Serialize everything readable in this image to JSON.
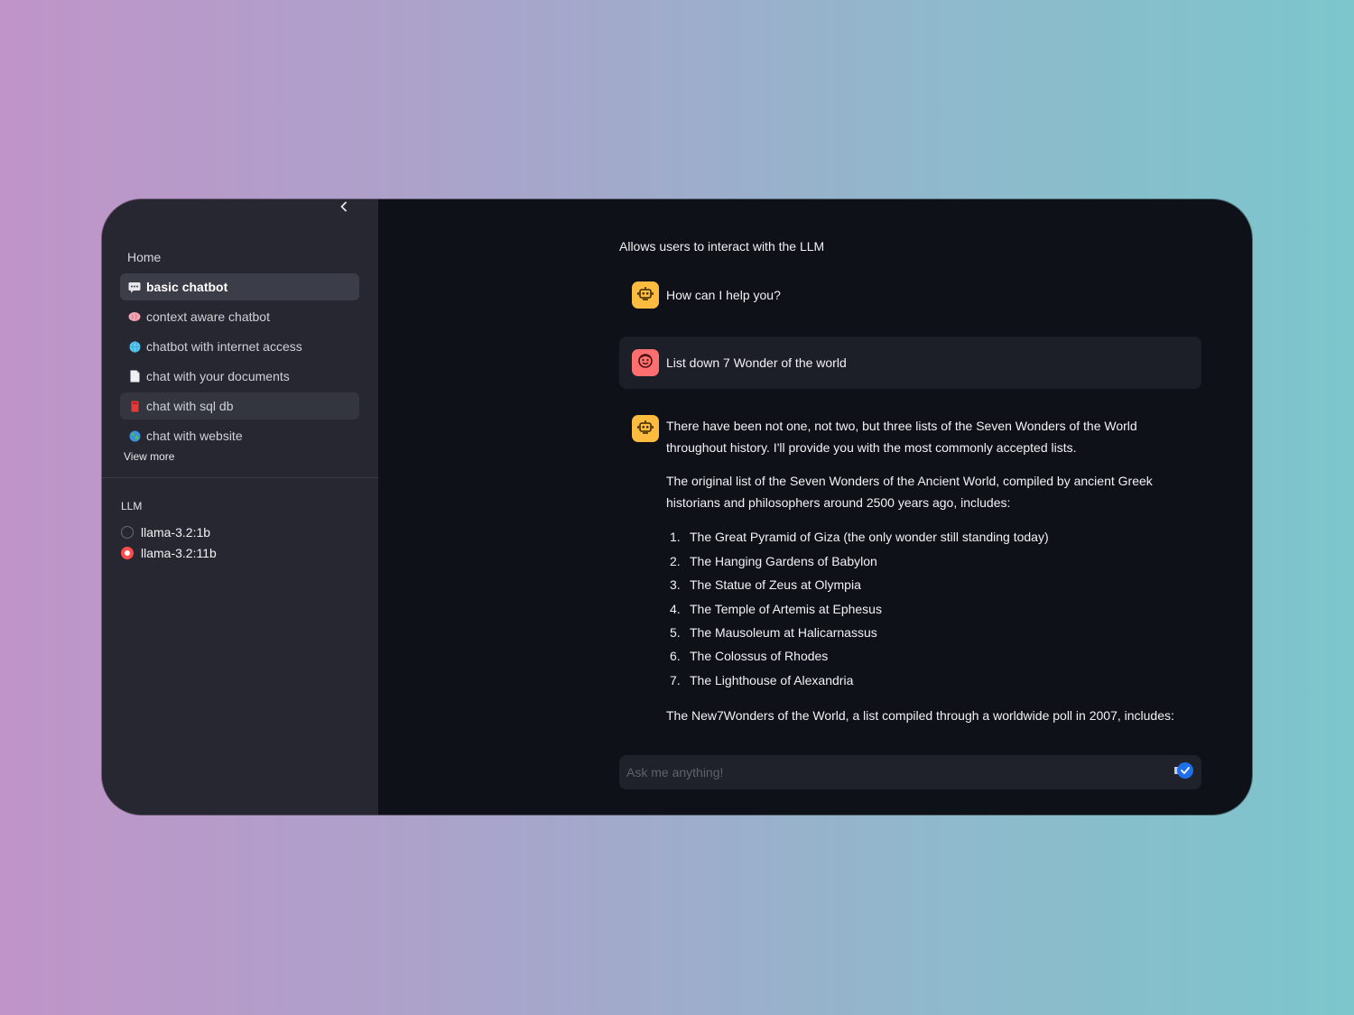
{
  "sidebar": {
    "home_label": "Home",
    "items": [
      {
        "label": "basic chatbot",
        "icon": "speech-bubble-icon"
      },
      {
        "label": "context aware chatbot",
        "icon": "brain-icon"
      },
      {
        "label": "chatbot with internet access",
        "icon": "globe-icon"
      },
      {
        "label": "chat with your documents",
        "icon": "document-icon"
      },
      {
        "label": "chat with sql db",
        "icon": "database-icon"
      },
      {
        "label": "chat with website",
        "icon": "earth-icon"
      }
    ],
    "view_more": "View more",
    "llm": {
      "label": "LLM",
      "options": [
        {
          "label": "llama-3.2:1b",
          "selected": false
        },
        {
          "label": "llama-3.2:11b",
          "selected": true
        }
      ]
    }
  },
  "main": {
    "caption": "Allows users to interact with the LLM",
    "messages": {
      "greeting": "How can I help you?",
      "user": "List down 7 Wonder of the world",
      "reply": {
        "intro": "There have been not one, not two, but three lists of the Seven Wonders of the World throughout history. I'll provide you with the most commonly accepted lists.",
        "ancient_intro": "The original list of the Seven Wonders of the Ancient World, compiled by ancient Greek historians and philosophers around 2500 years ago, includes:",
        "ancient_list": [
          {
            "num": "1.",
            "text": "The Great Pyramid of Giza (the only wonder still standing today)"
          },
          {
            "num": "2.",
            "text": "The Hanging Gardens of Babylon"
          },
          {
            "num": "3.",
            "text": "The Statue of Zeus at Olympia"
          },
          {
            "num": "4.",
            "text": "The Temple of Artemis at Ephesus"
          },
          {
            "num": "5.",
            "text": "The Mausoleum at Halicarnassus"
          },
          {
            "num": "6.",
            "text": "The Colossus of Rhodes"
          },
          {
            "num": "7.",
            "text": "The Lighthouse of Alexandria"
          }
        ],
        "new7_intro": "The New7Wonders of the World, a list compiled through a worldwide poll in 2007, includes:"
      }
    },
    "input": {
      "placeholder": "Ask me anything!"
    }
  },
  "colors": {
    "accent": "#ff4b4b",
    "bot_avatar": "#fdbc40",
    "user_avatar": "#ff6f6f",
    "send_button": "#1f6feb",
    "sidebar_bg": "#262730",
    "main_bg": "#0e1118"
  }
}
